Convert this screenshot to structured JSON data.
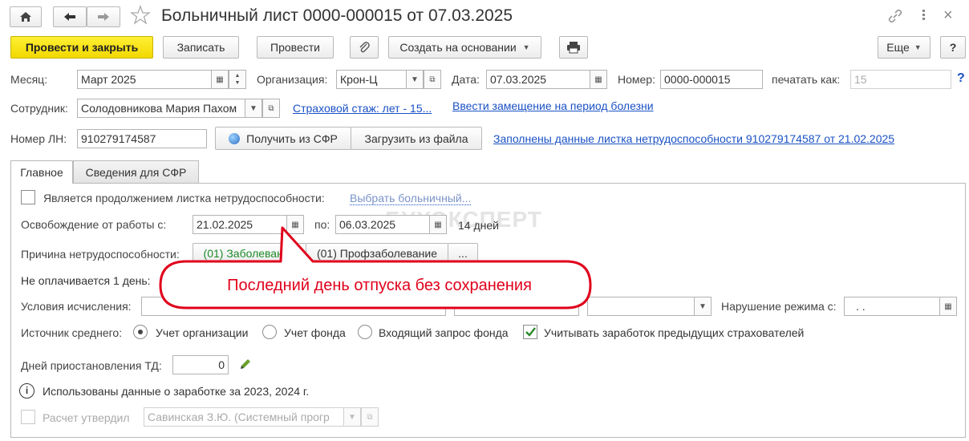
{
  "window": {
    "title": "Больничный лист 0000-000015 от 07.03.2025"
  },
  "toolbar": {
    "post_close": "Провести и закрыть",
    "save": "Записать",
    "post": "Провести",
    "create_based": "Создать на основании",
    "more": "Еще",
    "help": "?"
  },
  "header": {
    "month_label": "Месяц:",
    "month_value": "Март 2025",
    "org_label": "Организация:",
    "org_value": "Крон-Ц",
    "date_label": "Дата:",
    "date_value": "07.03.2025",
    "number_label": "Номер:",
    "number_value": "0000-000015",
    "print_as_label": "печатать как:",
    "print_as_value": "15",
    "help_q": "?",
    "employee_label": "Сотрудник:",
    "employee_value": "Солодовникова Мария Пахом",
    "insurance_link": "Страховой стаж: лет - 15...",
    "replacement_link": "Ввести замещение на период болезни",
    "ln_label": "Номер ЛН:",
    "ln_value": "910279174587",
    "get_sfr": "Получить из СФР",
    "load_file": "Загрузить из файла",
    "filled_link": "Заполнены данные листка нетрудоспособности 910279174587 от 21.02.2025"
  },
  "tabs": [
    {
      "label": "Главное"
    },
    {
      "label": "Сведения для СФР"
    }
  ],
  "main": {
    "continuation_label": "Является продолжением листка нетрудоспособности:",
    "choose_sick": "Выбрать больничный...",
    "release_label": "Освобождение от работы с:",
    "release_from": "21.02.2025",
    "to_label": "по:",
    "release_to": "06.03.2025",
    "days_text": "14 дней",
    "watermark": "БУХЭКСПЕРТ",
    "reason_label": "Причина нетрудоспособности:",
    "reason_disease": "(01) Заболевание",
    "reason_occupational": "(01) Профзаболевание",
    "reason_more": "...",
    "unpaid_label": "Не оплачивается 1 день:",
    "conditions_label": "Условия исчисления:",
    "violation_label": "Нарушение режима с:",
    "violation_value": ". .",
    "source_label": "Источник среднего:",
    "source_org": "Учет организации",
    "source_fund": "Учет фонда",
    "source_request": "Входящий запрос фонда",
    "prev_insurers": "Учитывать заработок предыдущих страхователей",
    "suspend_label": "Дней приостановления ТД:",
    "suspend_value": "0",
    "info_text": "Использованы данные о заработке за  2023,  2024 г.",
    "approved_label": "Расчет утвердил",
    "approved_value": "Савинская З.Ю. (Системный прогр"
  },
  "callout": {
    "text": "Последний день отпуска без сохранения",
    "color": "#e0001b"
  }
}
